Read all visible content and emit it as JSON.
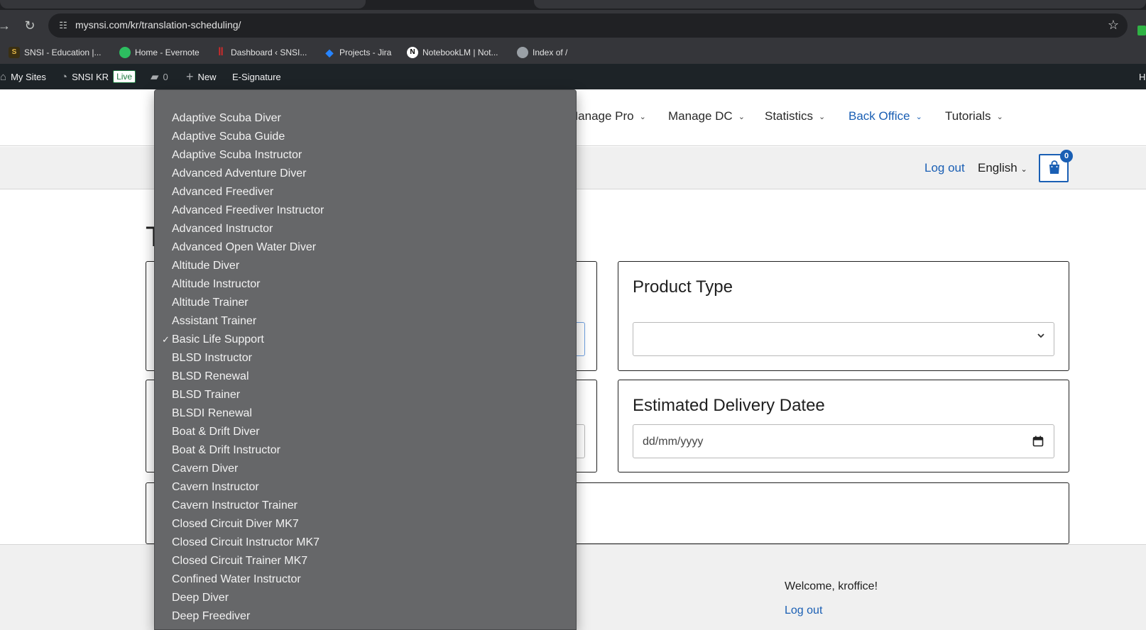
{
  "browser": {
    "url": "mysnsi.com/kr/translation-scheduling/",
    "bookmarks": [
      {
        "label": "SNSI - Education |...",
        "icon": "snsi-icon",
        "color": "#3a2f12"
      },
      {
        "label": "Home - Evernote",
        "icon": "evernote-icon",
        "color": "#2dbe60"
      },
      {
        "label": "Dashboard ‹ SNSI...",
        "icon": "dashboard-icon",
        "color": "#d42b2b"
      },
      {
        "label": "Projects - Jira",
        "icon": "jira-icon",
        "color": "#2684ff"
      },
      {
        "label": "NotebookLM | Not...",
        "icon": "notebooklm-icon",
        "color": "#ffffff"
      },
      {
        "label": "Index of /",
        "icon": "globe-icon",
        "color": "#9aa0a6"
      }
    ]
  },
  "adminbar": {
    "my_sites": "My Sites",
    "site_name": "SNSI KR",
    "live_badge": "Live",
    "comments_count": "0",
    "new_label": "New",
    "esignature": "E-Signature",
    "right_stub": "H"
  },
  "nav": {
    "items": [
      {
        "label": "Manage Pro",
        "active": false
      },
      {
        "label": "Manage DC",
        "active": false
      },
      {
        "label": "Statistics",
        "active": false
      },
      {
        "label": "Back Office",
        "active": true
      },
      {
        "label": "Tutorials",
        "active": false
      }
    ]
  },
  "subheader": {
    "logout": "Log out",
    "language": "English",
    "cart_count": "0"
  },
  "page": {
    "title_stub": "T"
  },
  "form": {
    "product_type": {
      "title": "Product Type",
      "selected": ""
    },
    "delivery": {
      "title": "Estimated Delivery Datee",
      "placeholder": "dd/mm/yyyy"
    }
  },
  "footer": {
    "welcome": "Welcome, kroffice!",
    "logout": "Log out"
  },
  "dropdown": {
    "selected": "Basic Life Support",
    "options": [
      "Adaptive Scuba Diver",
      "Adaptive Scuba Guide",
      "Adaptive Scuba Instructor",
      "Advanced Adventure Diver",
      "Advanced Freediver",
      "Advanced Freediver Instructor",
      "Advanced Instructor",
      "Advanced Open Water Diver",
      "Altitude Diver",
      "Altitude Instructor",
      "Altitude Trainer",
      "Assistant Trainer",
      "Basic Life Support",
      "BLSD Instructor",
      "BLSD Renewal",
      "BLSD Trainer",
      "BLSDI Renewal",
      "Boat & Drift Diver",
      "Boat & Drift Instructor",
      "Cavern Diver",
      "Cavern Instructor",
      "Cavern Instructor Trainer",
      "Closed Circuit Diver MK7",
      "Closed Circuit Instructor MK7",
      "Closed Circuit Trainer MK7",
      "Confined Water Instructor",
      "Deep Diver",
      "Deep Freediver"
    ]
  }
}
